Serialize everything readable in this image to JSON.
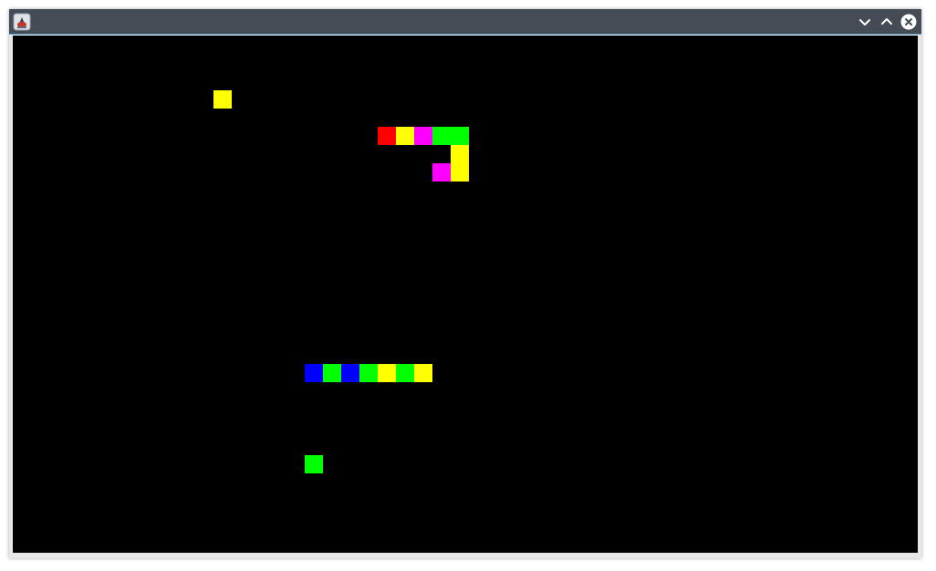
{
  "window": {
    "title_bar_color": "#464c55",
    "icons": {
      "app": "java-app-icon",
      "minimize": "chevron-down-icon",
      "maximize": "chevron-up-icon",
      "close": "close-circle-icon"
    }
  },
  "game": {
    "board_color": "#000000",
    "grid_unit": 20,
    "palette": {
      "red": "#ff0000",
      "yellow": "#ffff00",
      "magenta": "#ff00ff",
      "green": "#00ff00",
      "blue": "#0000ff"
    },
    "food": [
      {
        "col": 11,
        "row": 3,
        "color": "yellow"
      },
      {
        "col": 16,
        "row": 23,
        "color": "green"
      }
    ],
    "snakes": [
      {
        "segments": [
          {
            "col": 20,
            "row": 5,
            "color": "red"
          },
          {
            "col": 21,
            "row": 5,
            "color": "yellow"
          },
          {
            "col": 22,
            "row": 5,
            "color": "magenta"
          },
          {
            "col": 23,
            "row": 5,
            "color": "green"
          },
          {
            "col": 24,
            "row": 5,
            "color": "green"
          },
          {
            "col": 24,
            "row": 6,
            "color": "yellow"
          },
          {
            "col": 24,
            "row": 7,
            "color": "yellow"
          },
          {
            "col": 23,
            "row": 7,
            "color": "magenta"
          }
        ]
      },
      {
        "segments": [
          {
            "col": 16,
            "row": 18,
            "color": "blue"
          },
          {
            "col": 17,
            "row": 18,
            "color": "green"
          },
          {
            "col": 18,
            "row": 18,
            "color": "blue"
          },
          {
            "col": 19,
            "row": 18,
            "color": "green"
          },
          {
            "col": 20,
            "row": 18,
            "color": "yellow"
          },
          {
            "col": 21,
            "row": 18,
            "color": "green"
          },
          {
            "col": 22,
            "row": 18,
            "color": "yellow"
          }
        ]
      }
    ]
  }
}
